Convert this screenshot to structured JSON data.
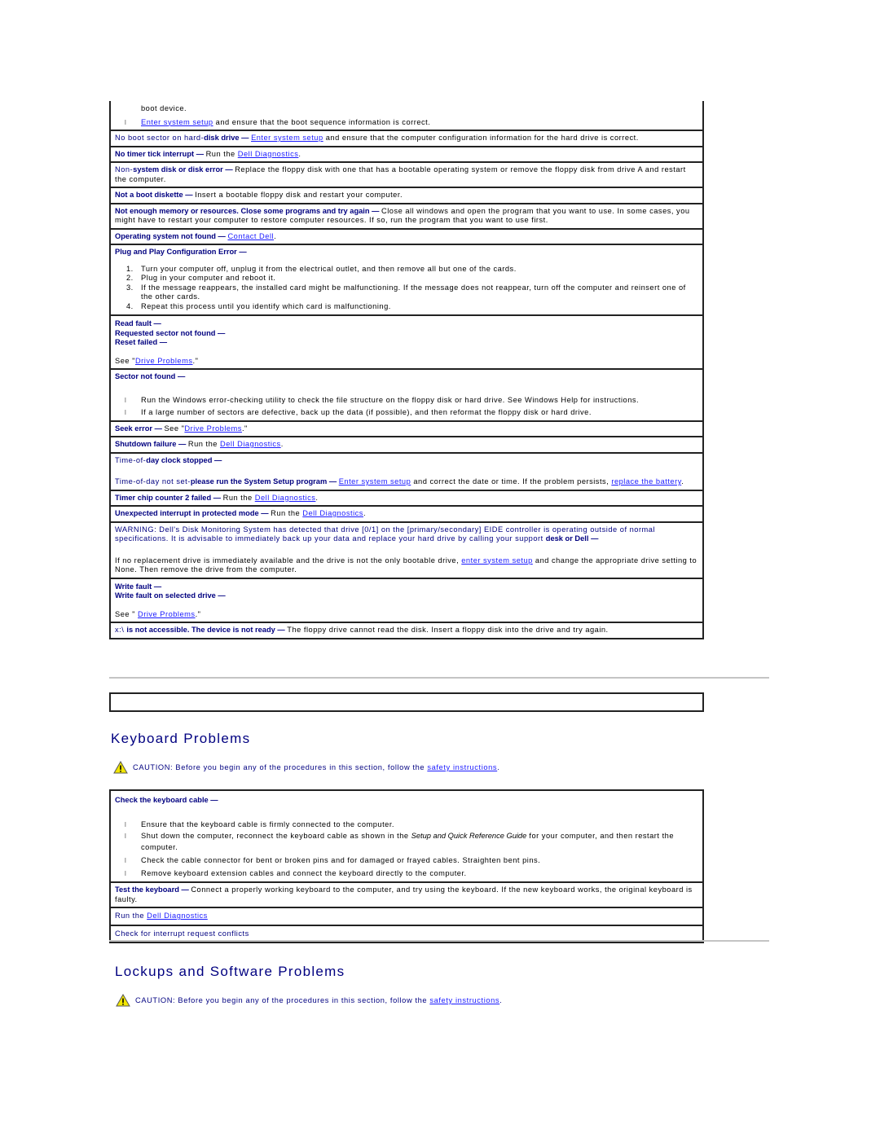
{
  "error_table": {
    "row0": {
      "text_top": "boot device.",
      "bullet_link": "Enter system setup",
      "bullet_rest": " and ensure that the boot sequence information is correct."
    },
    "row1": {
      "plain": "No boot sector on hard-",
      "bold": "disk drive",
      "dash": " — ",
      "link": "Enter system setup",
      "rest": " and ensure that the computer configuration information for the hard drive is correct."
    },
    "row2": {
      "bold": "No timer tick interrupt",
      "dash": " — ",
      "pre": "Run the ",
      "link": "Dell Diagnostics",
      "post": "."
    },
    "row3": {
      "plain": "Non-",
      "bold": "system disk or disk error",
      "dash": " — ",
      "rest": "Replace the floppy disk with one that has a bootable operating system or remove the floppy disk from drive A and restart the computer."
    },
    "row4": {
      "bold": "Not a boot diskette",
      "dash": " — ",
      "rest": "Insert a bootable floppy disk and restart your computer."
    },
    "row5": {
      "bold": "Not enough memory or resources. Close some programs and try again",
      "dash": " — ",
      "rest": "Close all windows and open the program that you want to use. In some cases, you might have to restart your computer to restore computer resources. If so, run the program that you want to use first."
    },
    "row6": {
      "bold": "Operating system not found",
      "dash": " — ",
      "link": "Contact Dell",
      "post": "."
    },
    "row7": {
      "bold": "Plug and Play Configuration Error",
      "dash": " —",
      "steps": [
        "Turn your computer off, unplug it from the electrical outlet, and then remove all but one of the cards.",
        "Plug in your computer and reboot it.",
        "If the message reappears, the installed card might be malfunctioning. If the message does not reappear, turn off the computer and reinsert one of the other cards.",
        "Repeat this process until you identify which card is malfunctioning."
      ]
    },
    "row8": {
      "lines": [
        "Read fault —",
        "Requested sector not found —",
        "Reset failed —"
      ],
      "see_pre": "See \"",
      "see_link": "Drive Problems",
      "see_post": ".\""
    },
    "row9": {
      "bold": "Sector not found",
      "dash": " —",
      "bullets": [
        "Run the Windows error-checking utility to check the file structure on the floppy disk or hard drive.  See Windows Help for instructions.",
        "If a large number of sectors are defective, back up the data (if possible), and then reformat the floppy disk or hard drive."
      ]
    },
    "row10": {
      "bold": "Seek error",
      "dash": " — ",
      "pre": "See \"",
      "link": "Drive Problems",
      "post": ".\""
    },
    "row11": {
      "bold": "Shutdown failure",
      "dash": " — ",
      "pre": "Run the ",
      "link": "Dell Diagnostics",
      "post": "."
    },
    "row12": {
      "l1_plain": "Time-of-",
      "l1_bold": "day clock stopped",
      "l1_dash": " —",
      "l2_plain": "Time-of-day not set-",
      "l2_bold": "please run the System Setup program",
      "l2_dash": " — ",
      "l2_link": "Enter system setup",
      "l2_rest": " and correct the date or time. If the problem persists, ",
      "l2_link2": "replace the battery",
      "l2_post": "."
    },
    "row13": {
      "bold": "Timer chip counter 2 failed",
      "dash": " — ",
      "pre": "Run the ",
      "link": "Dell Diagnostics",
      "post": "."
    },
    "row14": {
      "bold": "Unexpected interrupt in protected mode",
      "dash": " — ",
      "pre": "Run the ",
      "link": "Dell Diagnostics",
      "post": "."
    },
    "row15": {
      "warning": "WARNING: Dell's Disk Monitoring System has detected that drive [0/1] on the [primary/secondary] EIDE controller is operating outside of normal specifications. It is advisable to immediately back up your data and replace your hard drive by calling your support ",
      "bold": "desk or Dell",
      "dash": " —",
      "pre": " If no replacement drive is immediately available and the drive is not the only bootable drive, ",
      "link": "enter system setup",
      "rest": " and change the appropriate drive setting to None. Then remove the drive from the computer."
    },
    "row16": {
      "lines": [
        "Write fault —",
        "Write fault on selected drive —"
      ],
      "see_pre": "See \" ",
      "see_link": "Drive Problems",
      "see_post": ".\""
    },
    "row17": {
      "plain": "x:\\ ",
      "bold": "is not accessible. The device is not ready",
      "dash": " — ",
      "rest": "The floppy drive cannot read the disk. Insert a floppy disk into the drive and try again."
    }
  },
  "keyboard": {
    "title": "Keyboard Problems",
    "caution_label": "CAUTION:",
    "caution_text": " Before you begin any of the procedures in this section, follow the ",
    "caution_link": "safety instructions",
    "caution_post": ".",
    "rows": {
      "cable": {
        "bold": "Check the keyboard cable",
        "dash": " —",
        "b1": "Ensure that the keyboard cable is firmly connected to the computer.",
        "b2_pre": "Shut down the computer, reconnect the keyboard cable as shown in the ",
        "b2_italic": "Setup and Quick Reference Guide",
        "b2_post": " for your computer, and then restart the computer.",
        "b3": "Check the cable connector for bent or broken pins and for damaged or frayed cables. Straighten bent pins.",
        "b4": "Remove keyboard extension cables and connect the keyboard directly to the computer."
      },
      "test": {
        "bold": "Test the keyboard",
        "dash": " — ",
        "rest": "Connect a properly working keyboard to the computer, and try using the keyboard. If the new keyboard works, the original keyboard is faulty."
      },
      "diag": {
        "pre": "Run the ",
        "link": "Dell Diagnostics"
      },
      "irq": {
        "text": "Check for interrupt request conflicts"
      }
    }
  },
  "lockups": {
    "title": "Lockups and Software Problems",
    "caution_label": "CAUTION:",
    "caution_text": " Before you begin any of the procedures in this section, follow the ",
    "caution_link": "safety instructions",
    "caution_post": "."
  },
  "icons": {
    "bullet": "l",
    "caution": "warning-triangle-icon"
  },
  "colors": {
    "heading": "#000080",
    "link": "#1a1aff",
    "border": "#222222",
    "rule": "#c4c4c4"
  }
}
